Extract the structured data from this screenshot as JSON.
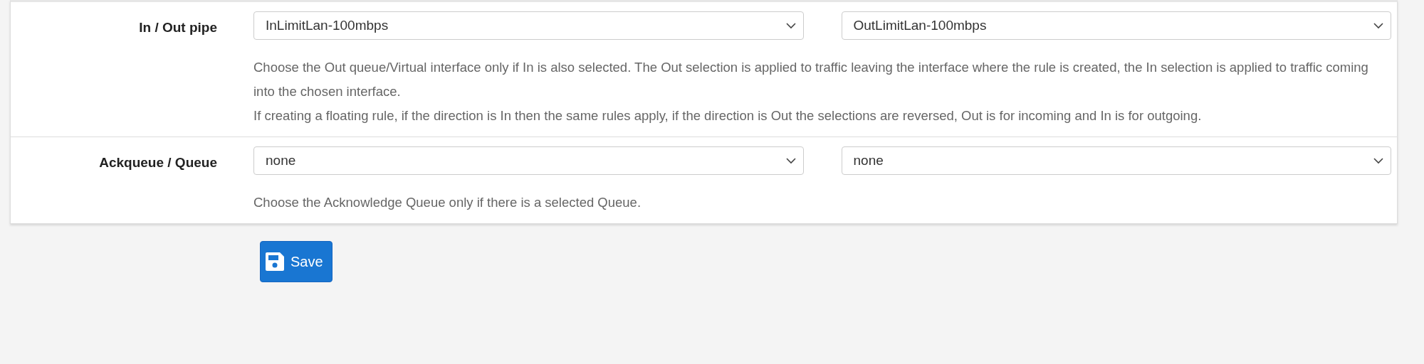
{
  "rows": [
    {
      "label": "In / Out pipe",
      "selects": [
        {
          "value": "InLimitLan-100mbps"
        },
        {
          "value": "OutLimitLan-100mbps"
        }
      ],
      "help": [
        "Choose the Out queue/Virtual interface only if In is also selected. The Out selection is applied to traffic leaving the interface where the rule is created, the In selection is applied to traffic coming into the chosen interface.",
        "If creating a floating rule, if the direction is In then the same rules apply, if the direction is Out the selections are reversed, Out is for incoming and In is for outgoing."
      ]
    },
    {
      "label": "Ackqueue / Queue",
      "selects": [
        {
          "value": "none"
        },
        {
          "value": "none"
        }
      ],
      "help": [
        "Choose the Acknowledge Queue only if there is a selected Queue."
      ]
    }
  ],
  "save_button": {
    "label": "Save"
  }
}
